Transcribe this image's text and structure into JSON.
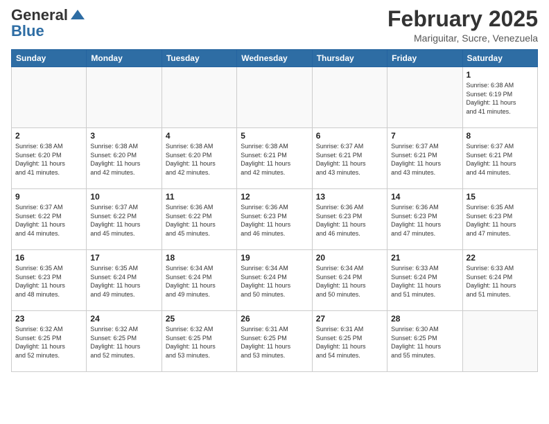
{
  "header": {
    "logo_general": "General",
    "logo_blue": "Blue",
    "month_title": "February 2025",
    "location": "Mariguitar, Sucre, Venezuela"
  },
  "calendar": {
    "days_of_week": [
      "Sunday",
      "Monday",
      "Tuesday",
      "Wednesday",
      "Thursday",
      "Friday",
      "Saturday"
    ],
    "weeks": [
      [
        {
          "day": "",
          "info": ""
        },
        {
          "day": "",
          "info": ""
        },
        {
          "day": "",
          "info": ""
        },
        {
          "day": "",
          "info": ""
        },
        {
          "day": "",
          "info": ""
        },
        {
          "day": "",
          "info": ""
        },
        {
          "day": "1",
          "info": "Sunrise: 6:38 AM\nSunset: 6:19 PM\nDaylight: 11 hours\nand 41 minutes."
        }
      ],
      [
        {
          "day": "2",
          "info": "Sunrise: 6:38 AM\nSunset: 6:20 PM\nDaylight: 11 hours\nand 41 minutes."
        },
        {
          "day": "3",
          "info": "Sunrise: 6:38 AM\nSunset: 6:20 PM\nDaylight: 11 hours\nand 42 minutes."
        },
        {
          "day": "4",
          "info": "Sunrise: 6:38 AM\nSunset: 6:20 PM\nDaylight: 11 hours\nand 42 minutes."
        },
        {
          "day": "5",
          "info": "Sunrise: 6:38 AM\nSunset: 6:21 PM\nDaylight: 11 hours\nand 42 minutes."
        },
        {
          "day": "6",
          "info": "Sunrise: 6:37 AM\nSunset: 6:21 PM\nDaylight: 11 hours\nand 43 minutes."
        },
        {
          "day": "7",
          "info": "Sunrise: 6:37 AM\nSunset: 6:21 PM\nDaylight: 11 hours\nand 43 minutes."
        },
        {
          "day": "8",
          "info": "Sunrise: 6:37 AM\nSunset: 6:21 PM\nDaylight: 11 hours\nand 44 minutes."
        }
      ],
      [
        {
          "day": "9",
          "info": "Sunrise: 6:37 AM\nSunset: 6:22 PM\nDaylight: 11 hours\nand 44 minutes."
        },
        {
          "day": "10",
          "info": "Sunrise: 6:37 AM\nSunset: 6:22 PM\nDaylight: 11 hours\nand 45 minutes."
        },
        {
          "day": "11",
          "info": "Sunrise: 6:36 AM\nSunset: 6:22 PM\nDaylight: 11 hours\nand 45 minutes."
        },
        {
          "day": "12",
          "info": "Sunrise: 6:36 AM\nSunset: 6:23 PM\nDaylight: 11 hours\nand 46 minutes."
        },
        {
          "day": "13",
          "info": "Sunrise: 6:36 AM\nSunset: 6:23 PM\nDaylight: 11 hours\nand 46 minutes."
        },
        {
          "day": "14",
          "info": "Sunrise: 6:36 AM\nSunset: 6:23 PM\nDaylight: 11 hours\nand 47 minutes."
        },
        {
          "day": "15",
          "info": "Sunrise: 6:35 AM\nSunset: 6:23 PM\nDaylight: 11 hours\nand 47 minutes."
        }
      ],
      [
        {
          "day": "16",
          "info": "Sunrise: 6:35 AM\nSunset: 6:23 PM\nDaylight: 11 hours\nand 48 minutes."
        },
        {
          "day": "17",
          "info": "Sunrise: 6:35 AM\nSunset: 6:24 PM\nDaylight: 11 hours\nand 49 minutes."
        },
        {
          "day": "18",
          "info": "Sunrise: 6:34 AM\nSunset: 6:24 PM\nDaylight: 11 hours\nand 49 minutes."
        },
        {
          "day": "19",
          "info": "Sunrise: 6:34 AM\nSunset: 6:24 PM\nDaylight: 11 hours\nand 50 minutes."
        },
        {
          "day": "20",
          "info": "Sunrise: 6:34 AM\nSunset: 6:24 PM\nDaylight: 11 hours\nand 50 minutes."
        },
        {
          "day": "21",
          "info": "Sunrise: 6:33 AM\nSunset: 6:24 PM\nDaylight: 11 hours\nand 51 minutes."
        },
        {
          "day": "22",
          "info": "Sunrise: 6:33 AM\nSunset: 6:24 PM\nDaylight: 11 hours\nand 51 minutes."
        }
      ],
      [
        {
          "day": "23",
          "info": "Sunrise: 6:32 AM\nSunset: 6:25 PM\nDaylight: 11 hours\nand 52 minutes."
        },
        {
          "day": "24",
          "info": "Sunrise: 6:32 AM\nSunset: 6:25 PM\nDaylight: 11 hours\nand 52 minutes."
        },
        {
          "day": "25",
          "info": "Sunrise: 6:32 AM\nSunset: 6:25 PM\nDaylight: 11 hours\nand 53 minutes."
        },
        {
          "day": "26",
          "info": "Sunrise: 6:31 AM\nSunset: 6:25 PM\nDaylight: 11 hours\nand 53 minutes."
        },
        {
          "day": "27",
          "info": "Sunrise: 6:31 AM\nSunset: 6:25 PM\nDaylight: 11 hours\nand 54 minutes."
        },
        {
          "day": "28",
          "info": "Sunrise: 6:30 AM\nSunset: 6:25 PM\nDaylight: 11 hours\nand 55 minutes."
        },
        {
          "day": "",
          "info": ""
        }
      ]
    ]
  }
}
